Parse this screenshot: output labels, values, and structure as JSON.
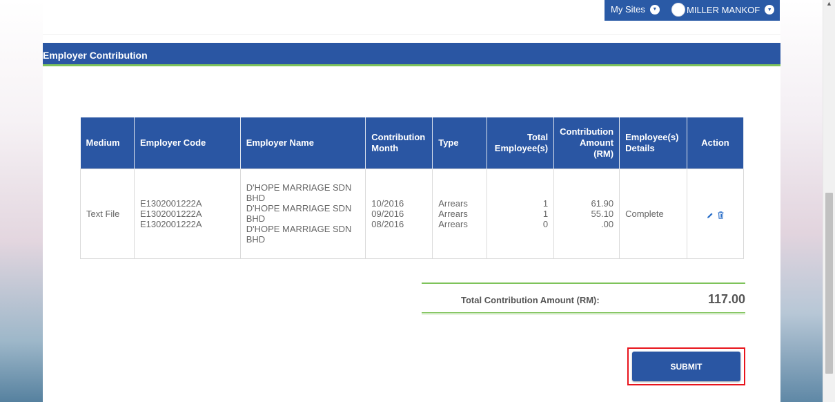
{
  "header": {
    "my_sites_label": "My Sites",
    "user_name": "MILLER MANKOF"
  },
  "section": {
    "title": "Employer Contribution"
  },
  "table": {
    "columns": {
      "medium": "Medium",
      "employer_code": "Employer Code",
      "employer_name": "Employer Name",
      "contribution_month": [
        "Contribution",
        "Month"
      ],
      "type": "Type",
      "total_employees": [
        "Total",
        "Employee(s)"
      ],
      "contribution_amount": [
        "Contribution",
        "Amount",
        "(RM)"
      ],
      "employee_details": [
        "Employee(s)",
        "Details"
      ],
      "action": "Action"
    },
    "row": {
      "medium": "Text File",
      "employer_codes": [
        "E1302001222A",
        "E1302001222A",
        "E1302001222A"
      ],
      "employer_names": [
        "D'HOPE MARRIAGE SDN",
        "BHD",
        "D'HOPE MARRIAGE SDN",
        "BHD",
        "D'HOPE MARRIAGE SDN",
        "BHD"
      ],
      "months": [
        "10/2016",
        "09/2016",
        "08/2016"
      ],
      "types": [
        "Arrears",
        "Arrears",
        "Arrears"
      ],
      "employees": [
        "1",
        "1",
        "0"
      ],
      "amounts": [
        "61.90",
        "55.10",
        ".00"
      ],
      "details": "Complete"
    }
  },
  "total": {
    "label": "Total Contribution Amount (RM):",
    "value": "117.00"
  },
  "submit": {
    "label": "SUBMIT"
  },
  "colors": {
    "primary": "#2a56a3",
    "accent_green": "#7ec35a",
    "highlight_red": "#e8141c"
  }
}
